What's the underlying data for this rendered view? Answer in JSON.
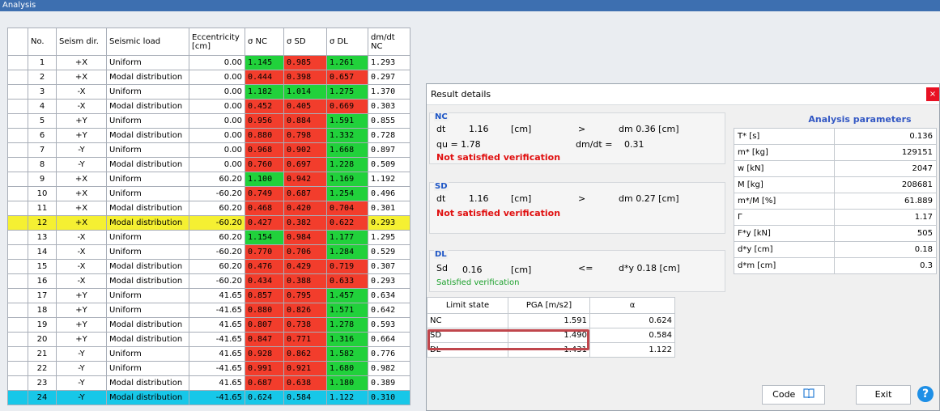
{
  "analysis_title": "Analysis",
  "headers": [
    "No.",
    "Seism dir.",
    "Seismic load",
    "Eccentricity [cm]",
    "σ NC",
    "σ SD",
    "σ DL",
    "dm/dt NC"
  ],
  "rows": [
    {
      "no": "1",
      "dir": "+X",
      "load": "Uniform",
      "ecc": "0.00",
      "nc": "1.145",
      "sd": "0.985",
      "dl": "1.261",
      "dmdt": "1.293",
      "nc_c": "g",
      "sd_c": "rd",
      "dl_c": "g"
    },
    {
      "no": "2",
      "dir": "+X",
      "load": "Modal distribution",
      "ecc": "0.00",
      "nc": "0.444",
      "sd": "0.398",
      "dl": "0.657",
      "dmdt": "0.297",
      "nc_c": "rd",
      "sd_c": "rd",
      "dl_c": "rd"
    },
    {
      "no": "3",
      "dir": "-X",
      "load": "Uniform",
      "ecc": "0.00",
      "nc": "1.182",
      "sd": "1.014",
      "dl": "1.275",
      "dmdt": "1.370",
      "nc_c": "g",
      "sd_c": "g",
      "dl_c": "g"
    },
    {
      "no": "4",
      "dir": "-X",
      "load": "Modal distribution",
      "ecc": "0.00",
      "nc": "0.452",
      "sd": "0.405",
      "dl": "0.669",
      "dmdt": "0.303",
      "nc_c": "rd",
      "sd_c": "rd",
      "dl_c": "rd"
    },
    {
      "no": "5",
      "dir": "+Y",
      "load": "Uniform",
      "ecc": "0.00",
      "nc": "0.956",
      "sd": "0.884",
      "dl": "1.591",
      "dmdt": "0.855",
      "nc_c": "rd",
      "sd_c": "rd",
      "dl_c": "g"
    },
    {
      "no": "6",
      "dir": "+Y",
      "load": "Modal distribution",
      "ecc": "0.00",
      "nc": "0.880",
      "sd": "0.798",
      "dl": "1.332",
      "dmdt": "0.728",
      "nc_c": "rd",
      "sd_c": "rd",
      "dl_c": "g"
    },
    {
      "no": "7",
      "dir": "-Y",
      "load": "Uniform",
      "ecc": "0.00",
      "nc": "0.968",
      "sd": "0.902",
      "dl": "1.668",
      "dmdt": "0.897",
      "nc_c": "rd",
      "sd_c": "rd",
      "dl_c": "g"
    },
    {
      "no": "8",
      "dir": "-Y",
      "load": "Modal distribution",
      "ecc": "0.00",
      "nc": "0.760",
      "sd": "0.697",
      "dl": "1.228",
      "dmdt": "0.509",
      "nc_c": "rd",
      "sd_c": "rd",
      "dl_c": "g"
    },
    {
      "no": "9",
      "dir": "+X",
      "load": "Uniform",
      "ecc": "60.20",
      "nc": "1.100",
      "sd": "0.942",
      "dl": "1.169",
      "dmdt": "1.192",
      "nc_c": "g",
      "sd_c": "rd",
      "dl_c": "g"
    },
    {
      "no": "10",
      "dir": "+X",
      "load": "Uniform",
      "ecc": "-60.20",
      "nc": "0.749",
      "sd": "0.687",
      "dl": "1.254",
      "dmdt": "0.496",
      "nc_c": "rd",
      "sd_c": "rd",
      "dl_c": "g"
    },
    {
      "no": "11",
      "dir": "+X",
      "load": "Modal distribution",
      "ecc": "60.20",
      "nc": "0.468",
      "sd": "0.420",
      "dl": "0.704",
      "dmdt": "0.301",
      "nc_c": "rd",
      "sd_c": "rd",
      "dl_c": "rd"
    },
    {
      "no": "12",
      "dir": "+X",
      "load": "Modal distribution",
      "ecc": "-60.20",
      "nc": "0.427",
      "sd": "0.382",
      "dl": "0.622",
      "dmdt": "0.293",
      "nc_c": "rd",
      "sd_c": "rd",
      "dl_c": "rd",
      "hl": "yellow"
    },
    {
      "no": "13",
      "dir": "-X",
      "load": "Uniform",
      "ecc": "60.20",
      "nc": "1.154",
      "sd": "0.984",
      "dl": "1.177",
      "dmdt": "1.295",
      "nc_c": "g",
      "sd_c": "rd",
      "dl_c": "g"
    },
    {
      "no": "14",
      "dir": "-X",
      "load": "Uniform",
      "ecc": "-60.20",
      "nc": "0.770",
      "sd": "0.706",
      "dl": "1.284",
      "dmdt": "0.529",
      "nc_c": "rd",
      "sd_c": "rd",
      "dl_c": "g"
    },
    {
      "no": "15",
      "dir": "-X",
      "load": "Modal distribution",
      "ecc": "60.20",
      "nc": "0.476",
      "sd": "0.429",
      "dl": "0.719",
      "dmdt": "0.307",
      "nc_c": "rd",
      "sd_c": "rd",
      "dl_c": "rd"
    },
    {
      "no": "16",
      "dir": "-X",
      "load": "Modal distribution",
      "ecc": "-60.20",
      "nc": "0.434",
      "sd": "0.388",
      "dl": "0.633",
      "dmdt": "0.293",
      "nc_c": "rd",
      "sd_c": "rd",
      "dl_c": "rd"
    },
    {
      "no": "17",
      "dir": "+Y",
      "load": "Uniform",
      "ecc": "41.65",
      "nc": "0.857",
      "sd": "0.795",
      "dl": "1.457",
      "dmdt": "0.634",
      "nc_c": "rd",
      "sd_c": "rd",
      "dl_c": "g"
    },
    {
      "no": "18",
      "dir": "+Y",
      "load": "Uniform",
      "ecc": "-41.65",
      "nc": "0.880",
      "sd": "0.826",
      "dl": "1.571",
      "dmdt": "0.642",
      "nc_c": "rd",
      "sd_c": "rd",
      "dl_c": "g"
    },
    {
      "no": "19",
      "dir": "+Y",
      "load": "Modal distribution",
      "ecc": "41.65",
      "nc": "0.807",
      "sd": "0.738",
      "dl": "1.278",
      "dmdt": "0.593",
      "nc_c": "rd",
      "sd_c": "rd",
      "dl_c": "g"
    },
    {
      "no": "20",
      "dir": "+Y",
      "load": "Modal distribution",
      "ecc": "-41.65",
      "nc": "0.847",
      "sd": "0.771",
      "dl": "1.316",
      "dmdt": "0.664",
      "nc_c": "rd",
      "sd_c": "rd",
      "dl_c": "g"
    },
    {
      "no": "21",
      "dir": "-Y",
      "load": "Uniform",
      "ecc": "41.65",
      "nc": "0.928",
      "sd": "0.862",
      "dl": "1.582",
      "dmdt": "0.776",
      "nc_c": "rd",
      "sd_c": "rd",
      "dl_c": "g"
    },
    {
      "no": "22",
      "dir": "-Y",
      "load": "Uniform",
      "ecc": "-41.65",
      "nc": "0.991",
      "sd": "0.921",
      "dl": "1.680",
      "dmdt": "0.982",
      "nc_c": "rd",
      "sd_c": "rd",
      "dl_c": "g"
    },
    {
      "no": "23",
      "dir": "-Y",
      "load": "Modal distribution",
      "ecc": "41.65",
      "nc": "0.687",
      "sd": "0.638",
      "dl": "1.180",
      "dmdt": "0.389",
      "nc_c": "rd",
      "sd_c": "rd",
      "dl_c": "g"
    },
    {
      "no": "24",
      "dir": "-Y",
      "load": "Modal distribution",
      "ecc": "-41.65",
      "nc": "0.624",
      "sd": "0.584",
      "dl": "1.122",
      "dmdt": "0.310",
      "nc_c": "n",
      "sd_c": "n",
      "dl_c": "n",
      "hl": "cyan"
    }
  ],
  "dialog": {
    "title": "Result details",
    "close": "×",
    "nc": {
      "label": "NC",
      "dt_label": "dt",
      "dt_value": "1.16",
      "dt_unit": "[cm]",
      "op": ">",
      "dm_text": "dm  0.36  [cm]",
      "qu_text": "qu =   1.78",
      "dmdt_label": "dm/dt =",
      "dmdt_value": "0.31",
      "status": "Not satisfied verification"
    },
    "sd": {
      "label": "SD",
      "dt_label": "dt",
      "dt_value": "1.16",
      "dt_unit": "[cm]",
      "op": ">",
      "dm_text": "dm  0.27  [cm]",
      "status": "Not satisfied verification"
    },
    "dl": {
      "label": "DL",
      "sd_label": "Sd",
      "sd_value": "0.16",
      "sd_unit": "[cm]",
      "op": "<=",
      "dy_text": "d*y  0.18  [cm]",
      "status": "Satisfied verification"
    },
    "limit_headers": [
      "Limit state",
      "PGA [m/s2]",
      "α"
    ],
    "limit_rows": [
      {
        "state": "NC",
        "pga": "1.591",
        "alpha": "0.624"
      },
      {
        "state": "SD",
        "pga": "1.490",
        "alpha": "0.584"
      },
      {
        "state": "DL",
        "pga": "1.431",
        "alpha": "1.122"
      }
    ],
    "params_title": "Analysis parameters",
    "params": [
      {
        "name": "T* [s]",
        "value": "0.136"
      },
      {
        "name": "m* [kg]",
        "value": "129151"
      },
      {
        "name": "w [kN]",
        "value": "2047"
      },
      {
        "name": "M [kg]",
        "value": "208681"
      },
      {
        "name": "m*/M [%]",
        "value": "61.889"
      },
      {
        "name": "Γ",
        "value": "1.17"
      },
      {
        "name": "F*y [kN]",
        "value": "505"
      },
      {
        "name": "d*y [cm]",
        "value": "0.18"
      },
      {
        "name": "d*m [cm]",
        "value": "0.3"
      }
    ],
    "code_label": "Code",
    "exit_label": "Exit",
    "help_label": "?"
  },
  "colors": {
    "pass": "#21d13b",
    "fail": "#f23d2c",
    "highlight_yellow": "#f5f032",
    "highlight_cyan": "#17c7e8",
    "title_bar": "#3d6fb0"
  },
  "icons": {
    "close": "close-icon",
    "book": "book-icon",
    "help": "help-icon"
  }
}
